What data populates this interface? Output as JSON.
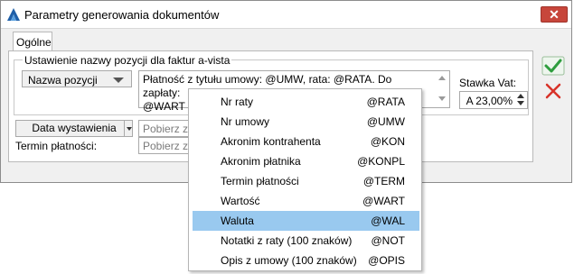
{
  "window": {
    "title": "Parametry generowania dokumentów",
    "close_label": "✕"
  },
  "tabs": [
    {
      "label": "Ogólne"
    }
  ],
  "group": {
    "label": "Ustawienie nazwy pozycji dla faktur a-vista"
  },
  "name_combo": {
    "label": "Nazwa pozycji"
  },
  "template_text": {
    "line1": "Płatność z tytułu umowy: @UMW, rata: @RATA. Do zapłaty:",
    "line2": "@WART"
  },
  "vat": {
    "label": "Stawka Vat:",
    "value": "A 23,00%"
  },
  "date_combo": {
    "label": "Data wystawienia"
  },
  "fields": {
    "date_placeholder": "Pobierz z ra",
    "term_label": "Termin płatności:",
    "term_placeholder": "Pobierz z ra"
  },
  "buttons": {
    "ok_color": "#2e9e3e",
    "cancel_color": "#d8332a"
  },
  "menu": {
    "items": [
      {
        "name": "Nr raty",
        "code": "@RATA"
      },
      {
        "name": "Nr umowy",
        "code": "@UMW"
      },
      {
        "name": "Akronim kontrahenta",
        "code": "@KON"
      },
      {
        "name": "Akronim płatnika",
        "code": "@KONPL"
      },
      {
        "name": "Termin płatności",
        "code": "@TERM"
      },
      {
        "name": "Wartość",
        "code": "@WART"
      },
      {
        "name": "Waluta",
        "code": "@WAL"
      },
      {
        "name": "Notatki z raty (100 znaków)",
        "code": "@NOT"
      },
      {
        "name": "Opis z umowy (100 znaków)",
        "code": "@OPIS"
      }
    ],
    "highlighted": "Waluta"
  }
}
